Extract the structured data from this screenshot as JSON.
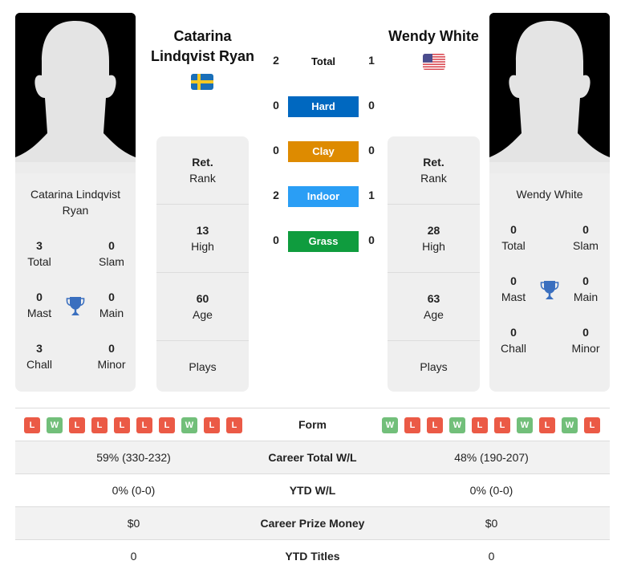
{
  "colors": {
    "hard": "#0068c0",
    "clay": "#de8b00",
    "indoor": "#2a9ef5",
    "grass": "#0f9c3e",
    "win": "#72bf7a",
    "loss": "#eb5a46",
    "trophy": "#3a6fbf"
  },
  "player1": {
    "header_line1": "Catarina",
    "header_line2": "Lindqvist Ryan",
    "flag_icon": "sweden-flag-icon",
    "card_name_line1": "Catarina Lindqvist",
    "card_name_line2": "Ryan",
    "titles": {
      "total": {
        "value": "3",
        "label": "Total"
      },
      "slam": {
        "value": "0",
        "label": "Slam"
      },
      "mast": {
        "value": "0",
        "label": "Mast"
      },
      "main": {
        "value": "0",
        "label": "Main"
      },
      "chall": {
        "value": "3",
        "label": "Chall"
      },
      "minor": {
        "value": "0",
        "label": "Minor"
      }
    },
    "rank": {
      "value": "Ret.",
      "label": "Rank"
    },
    "high": {
      "value": "13",
      "label": "High"
    },
    "age": {
      "value": "60",
      "label": "Age"
    },
    "plays": {
      "value": "",
      "label": "Plays"
    },
    "form": [
      "L",
      "W",
      "L",
      "L",
      "L",
      "L",
      "L",
      "W",
      "L",
      "L"
    ],
    "career_wl": "59% (330-232)",
    "ytd_wl": "0% (0-0)",
    "prize_money": "$0",
    "ytd_titles": "0"
  },
  "player2": {
    "header_line1": "Wendy White",
    "flag_icon": "usa-flag-icon",
    "card_name_line1": "Wendy White",
    "titles": {
      "total": {
        "value": "0",
        "label": "Total"
      },
      "slam": {
        "value": "0",
        "label": "Slam"
      },
      "mast": {
        "value": "0",
        "label": "Mast"
      },
      "main": {
        "value": "0",
        "label": "Main"
      },
      "chall": {
        "value": "0",
        "label": "Chall"
      },
      "minor": {
        "value": "0",
        "label": "Minor"
      }
    },
    "rank": {
      "value": "Ret.",
      "label": "Rank"
    },
    "high": {
      "value": "28",
      "label": "High"
    },
    "age": {
      "value": "63",
      "label": "Age"
    },
    "plays": {
      "value": "",
      "label": "Plays"
    },
    "form": [
      "W",
      "L",
      "L",
      "W",
      "L",
      "L",
      "W",
      "L",
      "W",
      "L"
    ],
    "career_wl": "48% (190-207)",
    "ytd_wl": "0% (0-0)",
    "prize_money": "$0",
    "ytd_titles": "0"
  },
  "h2h": {
    "total": {
      "label": "Total",
      "p1": "2",
      "p2": "1"
    },
    "hard": {
      "label": "Hard",
      "p1": "0",
      "p2": "0"
    },
    "clay": {
      "label": "Clay",
      "p1": "0",
      "p2": "0"
    },
    "indoor": {
      "label": "Indoor",
      "p1": "2",
      "p2": "1"
    },
    "grass": {
      "label": "Grass",
      "p1": "0",
      "p2": "0"
    }
  },
  "table": {
    "form_label": "Form",
    "career_wl_label": "Career Total W/L",
    "ytd_wl_label": "YTD W/L",
    "prize_label": "Career Prize Money",
    "ytd_titles_label": "YTD Titles"
  }
}
